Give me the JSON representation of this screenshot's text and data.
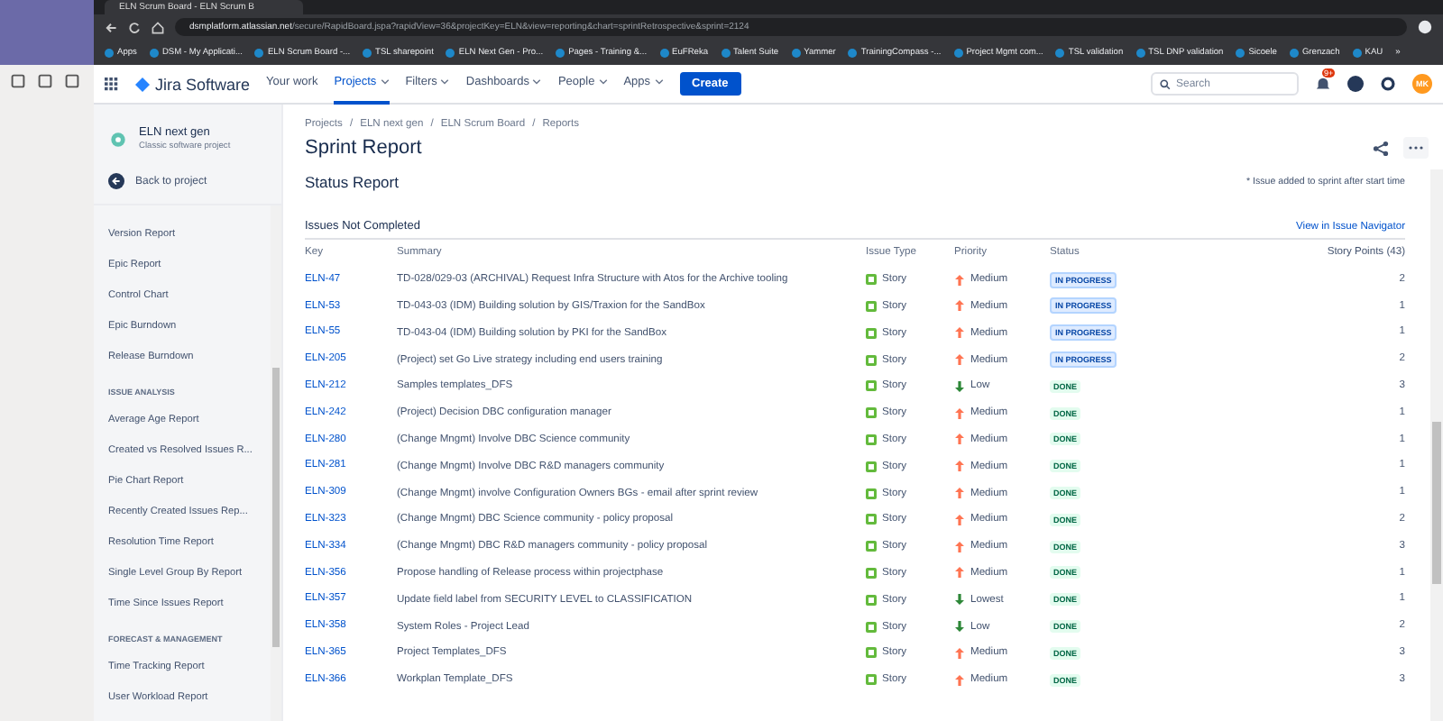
{
  "browser": {
    "tab_title": "ELN Scrum Board - ELN Scrum B",
    "address_domain": "dsmplatform.atlassian.net",
    "address_path": "/secure/RapidBoard.jspa?rapidView=36&projectKey=ELN&view=reporting&chart=sprintRetrospective&sprint=2124",
    "bookmarks": [
      "Apps",
      "DSM - My Applicati...",
      "ELN Scrum Board -...",
      "TSL sharepoint",
      "ELN Next Gen - Pro...",
      "Pages - Training &...",
      "EuFReka",
      "Talent Suite",
      "Yammer",
      "TrainingCompass -...",
      "Project Mgmt com...",
      "TSL validation",
      "TSL DNP validation",
      "Sicoele",
      "Grenzach",
      "KAU"
    ],
    "more": "»"
  },
  "nav": {
    "product": "Jira Software",
    "items": [
      {
        "label": "Your work",
        "dropdown": false,
        "selected": false
      },
      {
        "label": "Projects",
        "dropdown": true,
        "selected": true
      },
      {
        "label": "Filters",
        "dropdown": true,
        "selected": false
      },
      {
        "label": "Dashboards",
        "dropdown": true,
        "selected": false
      },
      {
        "label": "People",
        "dropdown": true,
        "selected": false
      },
      {
        "label": "Apps",
        "dropdown": true,
        "selected": false
      }
    ],
    "create": "Create",
    "search_placeholder": "Search",
    "notifications": "9+",
    "avatar": "MK"
  },
  "sidebar": {
    "project": "ELN next gen",
    "project_type": "Classic software project",
    "back": "Back to project",
    "items": [
      {
        "kind": "item",
        "label": "Version Report"
      },
      {
        "kind": "item",
        "label": "Epic Report"
      },
      {
        "kind": "item",
        "label": "Control Chart"
      },
      {
        "kind": "item",
        "label": "Epic Burndown"
      },
      {
        "kind": "item",
        "label": "Release Burndown"
      },
      {
        "kind": "heading",
        "label": "ISSUE ANALYSIS"
      },
      {
        "kind": "item",
        "label": "Average Age Report"
      },
      {
        "kind": "item",
        "label": "Created vs Resolved Issues R..."
      },
      {
        "kind": "item",
        "label": "Pie Chart Report"
      },
      {
        "kind": "item",
        "label": "Recently Created Issues Rep..."
      },
      {
        "kind": "item",
        "label": "Resolution Time Report"
      },
      {
        "kind": "item",
        "label": "Single Level Group By Report"
      },
      {
        "kind": "item",
        "label": "Time Since Issues Report"
      },
      {
        "kind": "heading",
        "label": "FORECAST & MANAGEMENT"
      },
      {
        "kind": "item",
        "label": "Time Tracking Report"
      },
      {
        "kind": "item",
        "label": "User Workload Report"
      }
    ]
  },
  "breadcrumbs": [
    "Projects",
    "/",
    "ELN next gen",
    "/",
    "ELN Scrum Board",
    "/",
    "Reports"
  ],
  "title": "Sprint Report",
  "section": "Status Report",
  "note": "* Issue added to sprint after start time",
  "table": {
    "title": "Issues Not Completed",
    "link": "View in Issue Navigator",
    "columns": [
      "Key",
      "Summary",
      "Issue Type",
      "Priority",
      "Status",
      "Story Points (43)"
    ],
    "rows": [
      {
        "key": "ELN-47",
        "summary": "TD-028/029-03 (ARCHIVAL) Request Infra Structure with Atos for the Archive tooling",
        "type": "Story",
        "priority": {
          "label": "Medium",
          "kind": "up"
        },
        "status": {
          "label": "IN PROGRESS",
          "kind": "progress"
        },
        "points": "2"
      },
      {
        "key": "ELN-53",
        "summary": "TD-043-03 (IDM) Building solution by GIS/Traxion for the SandBox",
        "type": "Story",
        "priority": {
          "label": "Medium",
          "kind": "up"
        },
        "status": {
          "label": "IN PROGRESS",
          "kind": "progress"
        },
        "points": "1"
      },
      {
        "key": "ELN-55",
        "summary": "TD-043-04 (IDM) Building solution by PKI for the SandBox",
        "type": "Story",
        "priority": {
          "label": "Medium",
          "kind": "up"
        },
        "status": {
          "label": "IN PROGRESS",
          "kind": "progress"
        },
        "points": "1"
      },
      {
        "key": "ELN-205",
        "summary": "(Project) set Go Live strategy including end users training",
        "type": "Story",
        "priority": {
          "label": "Medium",
          "kind": "up"
        },
        "status": {
          "label": "IN PROGRESS",
          "kind": "progress"
        },
        "points": "2"
      },
      {
        "key": "ELN-212",
        "summary": "Samples templates_DFS",
        "type": "Story",
        "priority": {
          "label": "Low",
          "kind": "down"
        },
        "status": {
          "label": "DONE",
          "kind": "complete"
        },
        "points": "3"
      },
      {
        "key": "ELN-242",
        "summary": "(Project) Decision DBC configuration manager",
        "type": "Story",
        "priority": {
          "label": "Medium",
          "kind": "up"
        },
        "status": {
          "label": "DONE",
          "kind": "complete"
        },
        "points": "1"
      },
      {
        "key": "ELN-280",
        "summary": "(Change Mngmt) Involve DBC Science community",
        "type": "Story",
        "priority": {
          "label": "Medium",
          "kind": "up"
        },
        "status": {
          "label": "DONE",
          "kind": "complete"
        },
        "points": "1"
      },
      {
        "key": "ELN-281",
        "summary": "(Change Mngmt) Involve DBC R&D managers community",
        "type": "Story",
        "priority": {
          "label": "Medium",
          "kind": "up"
        },
        "status": {
          "label": "DONE",
          "kind": "complete"
        },
        "points": "1"
      },
      {
        "key": "ELN-309",
        "summary": "(Change Mngmt) involve Configuration Owners BGs - email after sprint review",
        "type": "Story",
        "priority": {
          "label": "Medium",
          "kind": "up"
        },
        "status": {
          "label": "DONE",
          "kind": "complete"
        },
        "points": "1"
      },
      {
        "key": "ELN-323",
        "summary": "(Change Mngmt) DBC Science community - policy proposal",
        "type": "Story",
        "priority": {
          "label": "Medium",
          "kind": "up"
        },
        "status": {
          "label": "DONE",
          "kind": "complete"
        },
        "points": "2"
      },
      {
        "key": "ELN-334",
        "summary": "(Change Mngmt) DBC R&D managers community - policy proposal",
        "type": "Story",
        "priority": {
          "label": "Medium",
          "kind": "up"
        },
        "status": {
          "label": "DONE",
          "kind": "complete"
        },
        "points": "3"
      },
      {
        "key": "ELN-356",
        "summary": "Propose handling of Release process within projectphase",
        "type": "Story",
        "priority": {
          "label": "Medium",
          "kind": "up"
        },
        "status": {
          "label": "DONE",
          "kind": "complete"
        },
        "points": "1"
      },
      {
        "key": "ELN-357",
        "summary": "Update field label from SECURITY LEVEL to CLASSIFICATION",
        "type": "Story",
        "priority": {
          "label": "Lowest",
          "kind": "down"
        },
        "status": {
          "label": "DONE",
          "kind": "complete"
        },
        "points": "1"
      },
      {
        "key": "ELN-358",
        "summary": "System Roles - Project Lead",
        "type": "Story",
        "priority": {
          "label": "Low",
          "kind": "down"
        },
        "status": {
          "label": "DONE",
          "kind": "complete"
        },
        "points": "2"
      },
      {
        "key": "ELN-365",
        "summary": "Project Templates_DFS",
        "type": "Story",
        "priority": {
          "label": "Medium",
          "kind": "up"
        },
        "status": {
          "label": "DONE",
          "kind": "complete"
        },
        "points": "3"
      },
      {
        "key": "ELN-366",
        "summary": "Workplan Template_DFS",
        "type": "Story",
        "priority": {
          "label": "Medium",
          "kind": "up"
        },
        "status": {
          "label": "DONE",
          "kind": "complete"
        },
        "points": "3"
      }
    ]
  }
}
